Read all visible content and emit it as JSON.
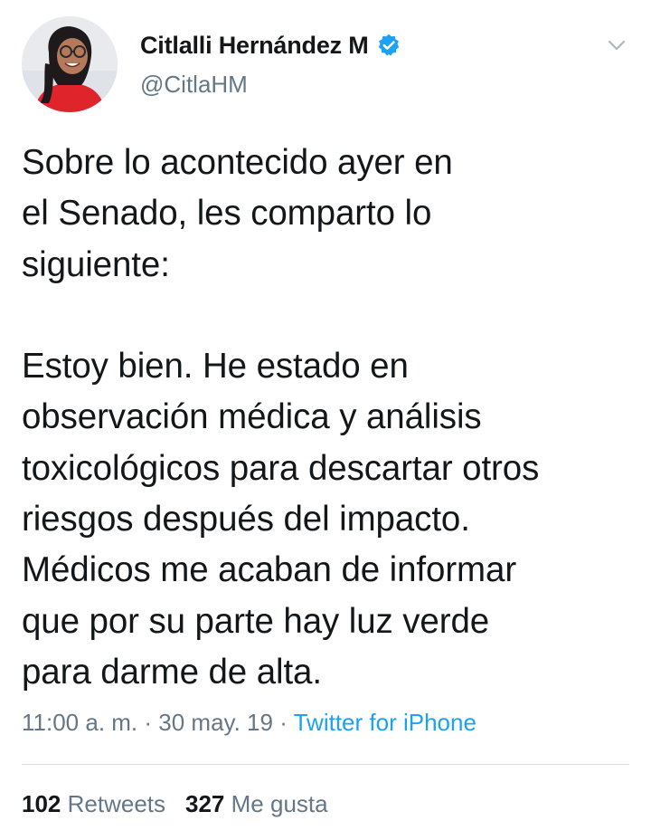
{
  "author": {
    "display_name": "Citlalli Hernández M",
    "handle": "@CitlaHM",
    "verified": true
  },
  "icons": {
    "verified": "verified-badge-icon",
    "menu": "chevron-down-icon"
  },
  "tweet": {
    "text": "Sobre lo acontecido ayer en\nel Senado, les comparto lo\nsiguiente:\n\nEstoy bien. He estado en\nobservación médica y análisis\ntoxicológicos para descartar otros\nriesgos después del impacto.\nMédicos me acaban de informar\nque por su parte hay luz verde\npara darme de alta.",
    "time": "11:00 a. m.",
    "separator": " · ",
    "date": "30 may. 19",
    "source": "Twitter for iPhone"
  },
  "stats": {
    "retweets_count": "102",
    "retweets_label": "Retweets",
    "likes_count": "327",
    "likes_label": "Me gusta"
  },
  "colors": {
    "link": "#1da1f2",
    "secondary_text": "#657786",
    "primary_text": "#14171a"
  }
}
